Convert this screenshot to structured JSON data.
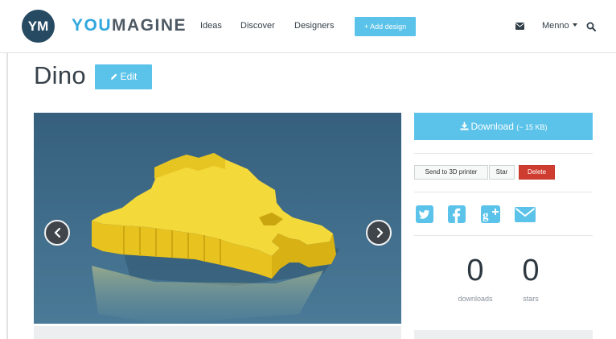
{
  "header": {
    "logo_initials": "YM",
    "brand_prefix": "YOU",
    "brand_suffix": "MAGINE",
    "nav": [
      {
        "label": "Ideas"
      },
      {
        "label": "Discover"
      },
      {
        "label": "Designers"
      }
    ],
    "add_design_label": "+ Add design",
    "user_name": "Menno",
    "icons": {
      "mail": "envelope-icon",
      "search": "search-icon",
      "caret": "caret-down-icon"
    }
  },
  "design": {
    "title": "Dino",
    "edit_label": "Edit"
  },
  "actions": {
    "download_label": "Download",
    "download_size": "(~ 15 KB)",
    "send_label": "Send to 3D printer",
    "star_label": "Star",
    "delete_label": "Delete"
  },
  "share": [
    "twitter-icon",
    "facebook-icon",
    "google-plus-icon",
    "envelope-icon"
  ],
  "stats": {
    "downloads_value": "0",
    "downloads_label": "downloads",
    "stars_value": "0",
    "stars_label": "stars"
  },
  "colors": {
    "accent": "#5bc3ea",
    "logo_bg": "#274a63",
    "danger": "#cf3d31",
    "model": "#f2d22e",
    "viewer_bg": "#3f6d8a"
  }
}
